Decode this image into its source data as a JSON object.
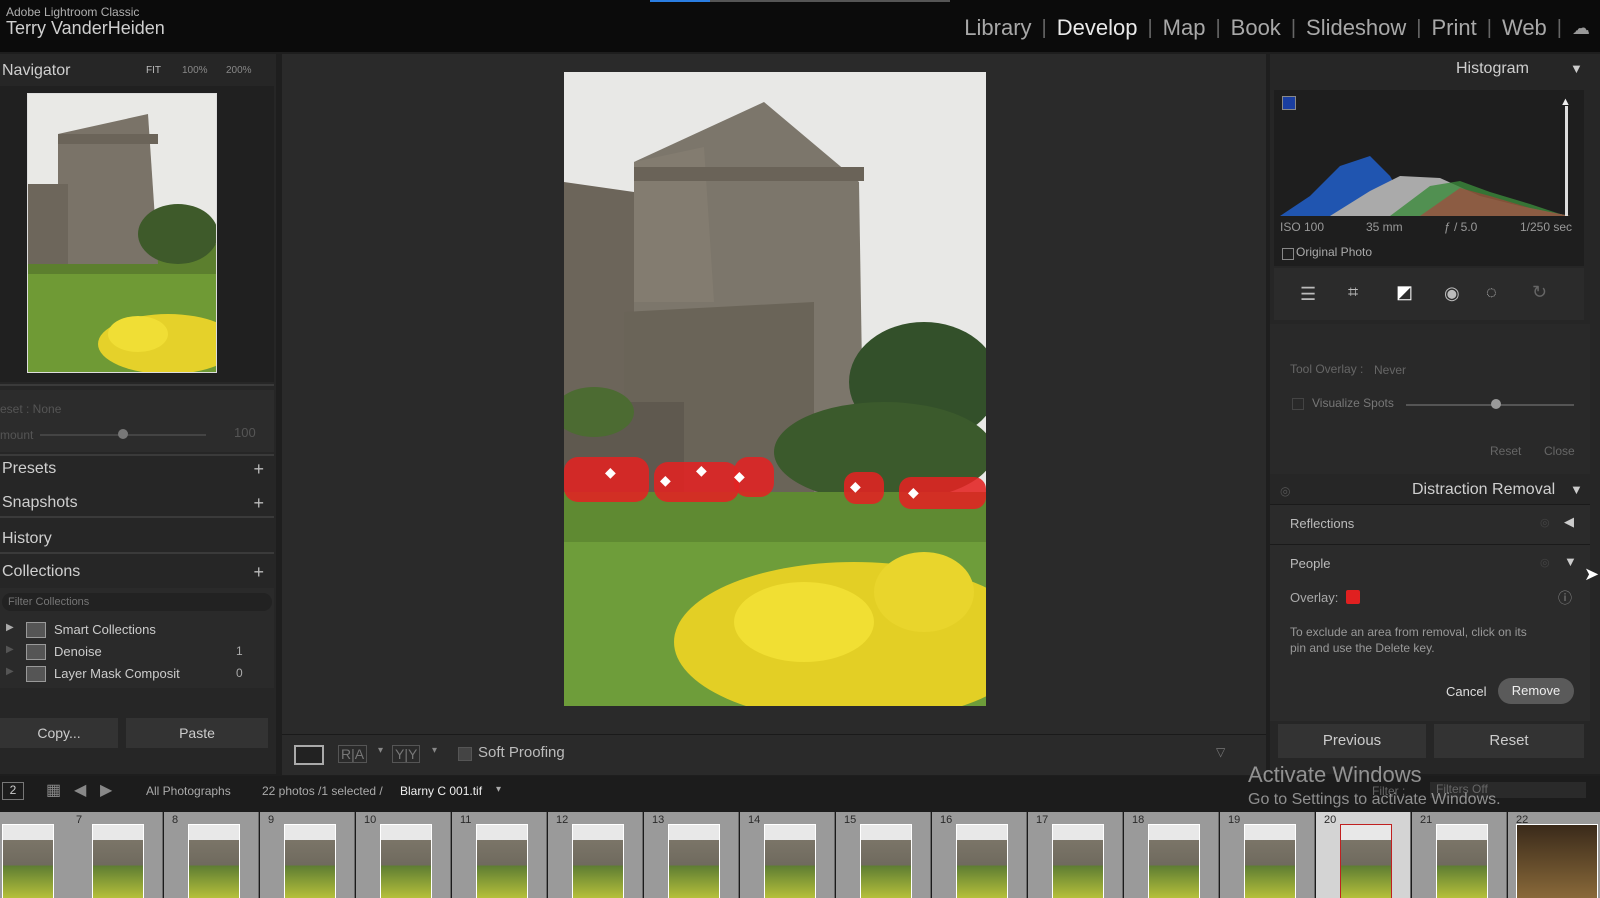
{
  "topbar": {
    "app_name": "Adobe Lightroom Classic",
    "user_name": "Terry VanderHeiden",
    "modules": [
      "Library",
      "Develop",
      "Map",
      "Book",
      "Slideshow",
      "Print",
      "Web"
    ],
    "active_module": "Develop"
  },
  "left": {
    "navigator": {
      "title": "Navigator",
      "zoom_fit": "FIT",
      "zoom_100": "100%",
      "zoom_200": "200%"
    },
    "preset_row": {
      "label": "eset : None",
      "amount_label": "mount",
      "amount_value": "100"
    },
    "presets": "Presets",
    "snapshots": "Snapshots",
    "history": "History",
    "collections": {
      "title": "Collections",
      "filter_placeholder": "Filter Collections",
      "items": [
        {
          "name": "Smart Collections",
          "count": ""
        },
        {
          "name": "Denoise",
          "count": "1"
        },
        {
          "name": "Layer Mask Composit",
          "count": "0"
        }
      ]
    },
    "copy": "Copy...",
    "paste": "Paste"
  },
  "toolbar": {
    "soft_proofing": "Soft Proofing",
    "ra": "R|A",
    "yy": "Y|Y"
  },
  "right": {
    "histogram": {
      "title": "Histogram",
      "iso": "ISO 100",
      "focal": "35 mm",
      "aperture": "ƒ / 5.0",
      "shutter": "1/250 sec",
      "original_photo": "Original Photo"
    },
    "tool_overlay": {
      "label": "Tool Overlay :",
      "value": "Never"
    },
    "visualize_spots": "Visualize Spots",
    "reset": "Reset",
    "close": "Close",
    "distraction": {
      "title": "Distraction Removal",
      "reflections": "Reflections",
      "people": "People",
      "overlay_label": "Overlay:",
      "overlay_color": "#e02020",
      "hint": "To exclude an area from removal, click on its pin and use the Delete key.",
      "cancel": "Cancel",
      "remove": "Remove"
    },
    "previous": "Previous",
    "reset_btn": "Reset"
  },
  "filmbar": {
    "page": "2",
    "source": "All Photographs",
    "count": "22 photos /1 selected /",
    "file": "Blarny C 001.tif",
    "filter": "Filter :",
    "filter_value": "Filters Off"
  },
  "watermark": {
    "line1": "Activate Windows",
    "line2": "Go to Settings to activate Windows."
  },
  "filmstrip": {
    "numbers": [
      "",
      "7",
      "8",
      "9",
      "10",
      "11",
      "12",
      "13",
      "14",
      "15",
      "16",
      "17",
      "18",
      "19",
      "20",
      "21",
      "22"
    ],
    "selected": "20"
  }
}
